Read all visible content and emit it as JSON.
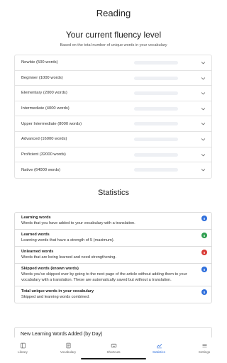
{
  "page": {
    "title": "Reading"
  },
  "fluency": {
    "title": "Your current fluency level",
    "subtitle": "Based on the total number of unique words in your vocabulary",
    "levels": [
      {
        "label": "Newbie (500 words)",
        "progress": 0
      },
      {
        "label": "Beginner (1000 words)",
        "progress": 0
      },
      {
        "label": "Elementary (2000 words)",
        "progress": 0
      },
      {
        "label": "Intermediate (4000 words)",
        "progress": 0
      },
      {
        "label": "Upper Intermediate (8000 words)",
        "progress": 0
      },
      {
        "label": "Advanced (16000 words)",
        "progress": 0
      },
      {
        "label": "Proficient (32000 words)",
        "progress": 0
      },
      {
        "label": "Native (64000 words)",
        "progress": 0
      }
    ]
  },
  "statistics": {
    "title": "Statistics",
    "items": [
      {
        "title": "Learning words",
        "desc": "Words that you have added to your vocabulary with a translation.",
        "count": "0",
        "color": "#2f6fdc"
      },
      {
        "title": "Learned words",
        "desc": "Learning words that have a strength of 5 (maximum).",
        "count": "0",
        "color": "#2e9e4f"
      },
      {
        "title": "Unlearned words",
        "desc": "Words that are being learned and need strengthening.",
        "count": "0",
        "color": "#d93a35"
      },
      {
        "title": "Skipped words (known words)",
        "desc": "Words you've skipped over by going to the next page of the article without adding them to your vocabulary with a translation. These are automatically saved but without a translation.",
        "count": "0",
        "color": "#2f6fdc"
      },
      {
        "title": "Total unique words in your vocabulary",
        "desc": "Skipped and learning words combined.",
        "count": "0",
        "color": "#2f6fdc"
      }
    ]
  },
  "daily": {
    "title": "New Learning Words Added (by Day)"
  },
  "nav": {
    "items": [
      {
        "label": "Library",
        "icon": "library-icon",
        "active": false
      },
      {
        "label": "Vocabulary",
        "icon": "vocabulary-icon",
        "active": false
      },
      {
        "label": "Shortcuts",
        "icon": "shortcuts-icon",
        "active": false
      },
      {
        "label": "Statistics",
        "icon": "statistics-icon",
        "active": true
      },
      {
        "label": "Settings",
        "icon": "settings-icon",
        "active": false
      }
    ],
    "active_color": "#2f6fdc"
  }
}
